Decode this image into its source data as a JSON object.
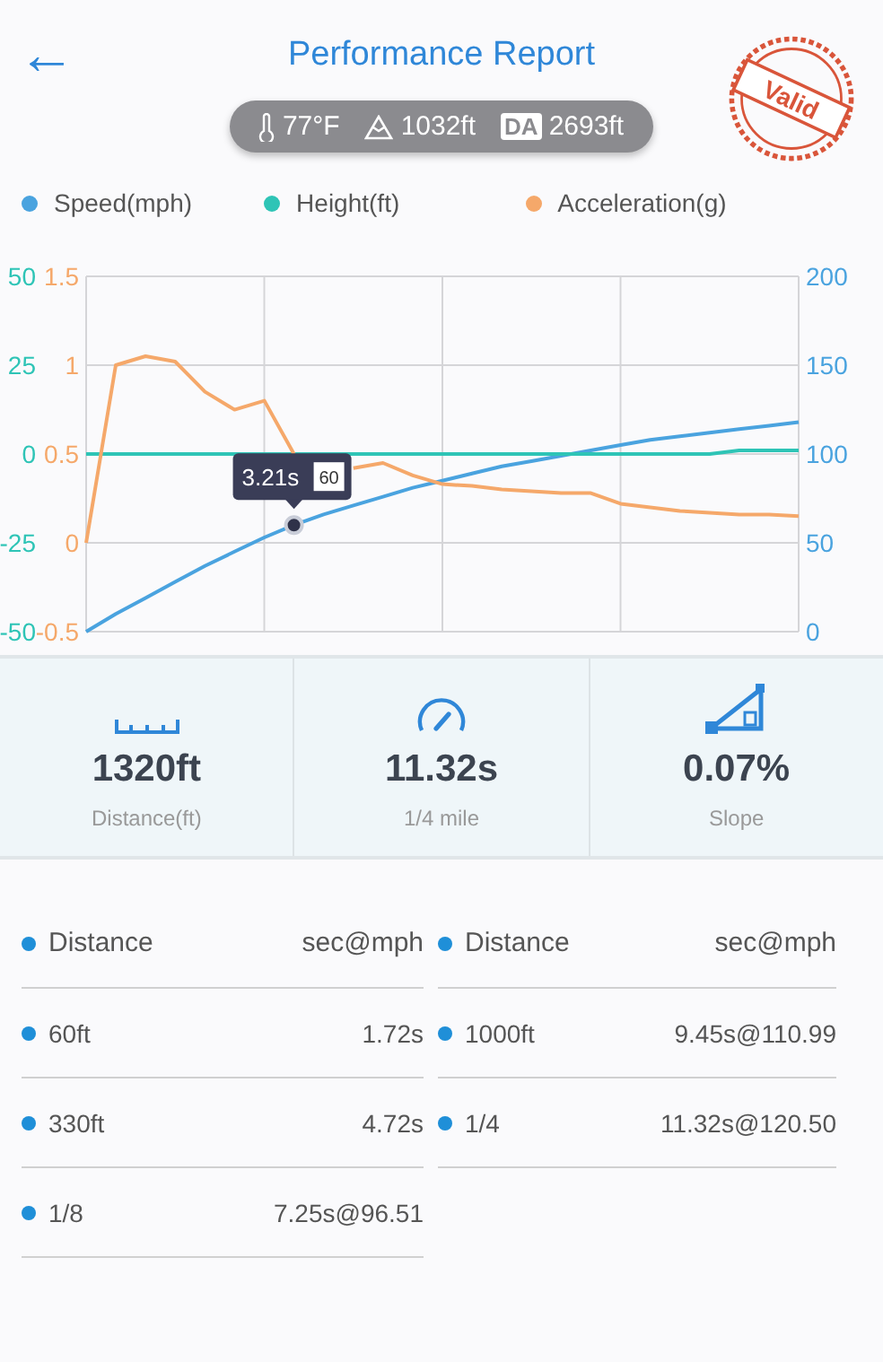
{
  "header": {
    "back": "←",
    "title": "Performance Report",
    "stamp": "Valid"
  },
  "conditions": [
    {
      "kind": "temperature",
      "text": "77°F"
    },
    {
      "kind": "altitude",
      "text": "1032ft"
    },
    {
      "kind": "density",
      "badge": "DA",
      "text": "2693ft"
    }
  ],
  "chart": {
    "chart_data": {
      "type": "line",
      "grid": true,
      "ylim": [
        0,
        200
      ],
      "yticks": [
        0,
        50,
        100,
        150,
        200
      ],
      "y2lim": [
        -0.5,
        1.5
      ],
      "y2ticks": [
        -0.5,
        0,
        0.5,
        1,
        1.5
      ],
      "y3lim": [
        -50,
        50
      ],
      "y3ticks": [
        -50,
        -25,
        0,
        25,
        50
      ],
      "series": [
        {
          "name": "Speed(mph)",
          "color": "#4aa3df",
          "values": [
            0,
            10,
            19,
            28,
            37,
            45,
            53,
            60,
            66,
            71,
            76,
            81,
            85,
            89,
            93,
            96,
            99,
            102,
            105,
            108,
            110,
            112,
            114,
            116,
            118
          ]
        },
        {
          "name": "Height(ft)",
          "color": "#2ec4b6",
          "axis": "y3",
          "values": [
            0,
            0,
            0,
            0,
            0,
            0,
            0,
            0,
            0,
            0,
            0,
            0,
            0,
            0,
            0,
            0,
            0,
            0,
            0,
            0,
            0,
            0,
            1,
            1,
            1
          ]
        },
        {
          "name": "Acceleration(g)",
          "color": "#f5a86a",
          "axis": "y2",
          "values": [
            0,
            1.0,
            1.05,
            1.02,
            0.85,
            0.75,
            0.8,
            0.5,
            null,
            0.42,
            0.45,
            0.38,
            0.33,
            0.32,
            0.3,
            0.29,
            0.28,
            0.28,
            0.22,
            0.2,
            0.18,
            0.17,
            0.16,
            0.16,
            0.15
          ]
        }
      ],
      "annotations": [
        "3.21s",
        "60"
      ]
    }
  },
  "stats": [
    {
      "kind": "ruler",
      "value": "1320ft",
      "label": "Distance(ft)"
    },
    {
      "kind": "gauge",
      "value": "11.32s",
      "label": "1/4 mile"
    },
    {
      "kind": "slope",
      "value": "0.07%",
      "label": "Slope"
    }
  ],
  "splits": [
    {
      "rows": [
        {
          "header": true,
          "name": "Distance",
          "time": "sec@mph"
        },
        {
          "header": false,
          "name": "60ft",
          "time": "1.72s"
        },
        {
          "header": false,
          "name": "330ft",
          "time": "4.72s"
        },
        {
          "header": false,
          "name": "1/8",
          "time": "7.25s@96.51"
        }
      ]
    },
    {
      "rows": [
        {
          "header": true,
          "name": "Distance",
          "time": "sec@mph"
        },
        {
          "header": false,
          "name": "1000ft",
          "time": "9.45s@110.99"
        },
        {
          "header": false,
          "name": "1/4",
          "time": "11.32s@120.50"
        }
      ]
    }
  ]
}
